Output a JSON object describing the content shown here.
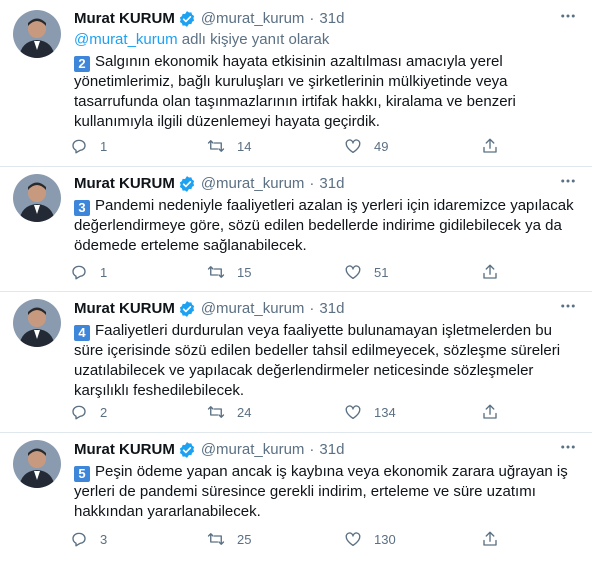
{
  "tweets": [
    {
      "name": "Murat KURUM",
      "handle": "@murat_kurum",
      "separator": "·",
      "time": "31d",
      "replying": {
        "mention": "@murat_kurum",
        "suffix": "adlı kişiye yanıt olarak"
      },
      "number": "2",
      "text": "Salgının ekonomik hayata etkisinin azaltılması amacıyla yerel yönetimlerimiz, bağlı kuruluşları ve şirketlerinin mülkiyetinde veya tasarrufunda olan taşınmazlarının irtifak hakkı, kiralama ve benzeri kullanımıyla ilgili düzenlemeyi hayata geçirdik.",
      "replies": "1",
      "retweets": "14",
      "likes": "49"
    },
    {
      "name": "Murat KURUM",
      "handle": "@murat_kurum",
      "separator": "·",
      "time": "31d",
      "number": "3",
      "text": "Pandemi nedeniyle faaliyetleri azalan iş yerleri için idaremizce yapılacak değerlendirmeye göre, sözü edilen bedellerde indirime gidilebilecek ya da ödemede erteleme sağlanabilecek.",
      "replies": "1",
      "retweets": "15",
      "likes": "51"
    },
    {
      "name": "Murat KURUM",
      "handle": "@murat_kurum",
      "separator": "·",
      "time": "31d",
      "number": "4",
      "text": "Faaliyetleri durdurulan veya faaliyette bulunamayan işletmelerden bu süre içerisinde sözü edilen bedeller tahsil edilmeyecek, sözleşme süreleri uzatılabilecek ve yapılacak değerlendirmeler neticesinde sözleşmeler karşılıklı feshedilebilecek.",
      "replies": "2",
      "retweets": "24",
      "likes": "134"
    },
    {
      "name": "Murat KURUM",
      "handle": "@murat_kurum",
      "separator": "·",
      "time": "31d",
      "number": "5",
      "text": "Peşin ödeme yapan ancak iş kaybına veya ekonomik zarara uğrayan iş yerleri de pandemi süresince gerekli indirim, erteleme ve süre uzatımı hakkından yararlanabilecek.",
      "replies": "3",
      "retweets": "25",
      "likes": "130"
    }
  ],
  "colors": {
    "verified": "#1da1f2",
    "icon_gray": "#5b7083",
    "number_box": "#3d86d9",
    "divider": "#e1e8ed"
  },
  "icons": {
    "verified": "verified-badge-icon",
    "more": "more-icon",
    "reply": "reply-icon",
    "retweet": "retweet-icon",
    "like": "heart-icon",
    "share": "share-icon"
  }
}
